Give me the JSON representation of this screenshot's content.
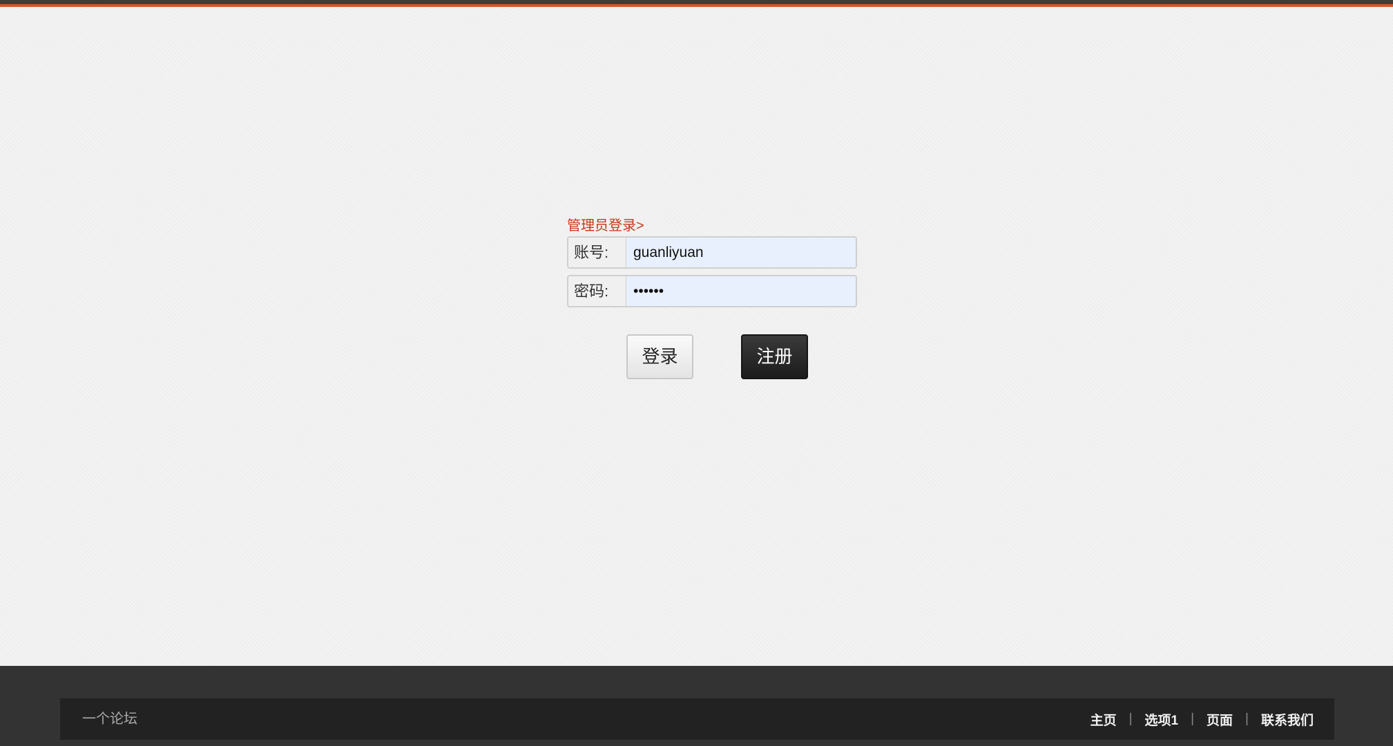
{
  "login": {
    "title": "管理员登录>",
    "account_label": "账号:",
    "account_value": "guanliyuan",
    "password_label": "密码:",
    "password_value": "••••••",
    "login_button": "登录",
    "register_button": "注册"
  },
  "footer": {
    "brand": "一个论坛",
    "nav": [
      "主页",
      "选项1",
      "页面",
      "联系我们"
    ],
    "separator": "|"
  },
  "colors": {
    "accent": "#d9532c",
    "title_red": "#c8381a",
    "input_bg": "#e8f0fe",
    "footer_bg": "#333333",
    "footer_inner_bg": "#222222"
  }
}
